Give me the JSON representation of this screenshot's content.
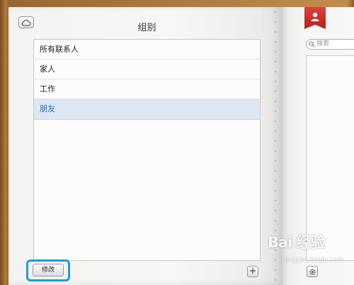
{
  "left_page": {
    "title": "组别",
    "groups": [
      {
        "label": "所有联系人",
        "selected": false
      },
      {
        "label": "家人",
        "selected": false
      },
      {
        "label": "工作",
        "selected": false
      },
      {
        "label": "朋友",
        "selected": true
      }
    ],
    "edit_label": "修改",
    "add_label": "+"
  },
  "right_page": {
    "search_placeholder": "搜索"
  },
  "icons": {
    "cloud": "icloud-icon",
    "bookmark": "contact-card-bookmark-icon",
    "search": "search-icon",
    "gear": "gear-icon"
  },
  "watermark": {
    "brand": "Bai 经验",
    "site": "jingyan.baidu.com"
  },
  "colors": {
    "selected_row_bg": "#dde7f1",
    "selected_row_text": "#2e6aa8",
    "highlight_ring": "#1d9be0",
    "bookmark_red": "#c8251f"
  }
}
